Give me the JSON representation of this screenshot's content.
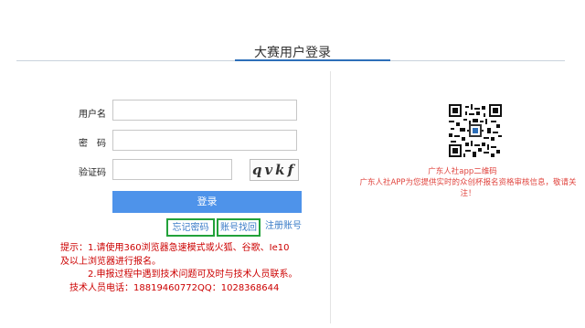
{
  "header": {
    "title": "大赛用户登录"
  },
  "form": {
    "username_label": "用户名",
    "password_label": "密　码",
    "captcha_label": "验证码",
    "username_value": "",
    "password_value": "",
    "captcha_value": "",
    "captcha_text": "qvkf",
    "login_label": "登录"
  },
  "links": {
    "forgot_password": "忘记密码",
    "find_account": "账号找回",
    "register": "注册账号"
  },
  "notes": [
    "提示：1.请使用360浏览器急速模式或火狐、谷歌、Ie10",
    "及以上浏览器进行报名。",
    "　　　2.申报过程中遇到技术问题可及时与技术人员联系。",
    "　技术人员电话：18819460772QQ：1028368644"
  ],
  "app_promo": {
    "caption": "广东人社app二维码",
    "description": "广东人社APP为您提供实时的众创杯报名资格审核信息，敬请关注！"
  },
  "colors": {
    "accent": "#4e93ea",
    "title_underline": "#2d6fb9",
    "highlight_box": "#22a23a",
    "note_text": "#cc0000",
    "promo_text": "#e0443e"
  }
}
